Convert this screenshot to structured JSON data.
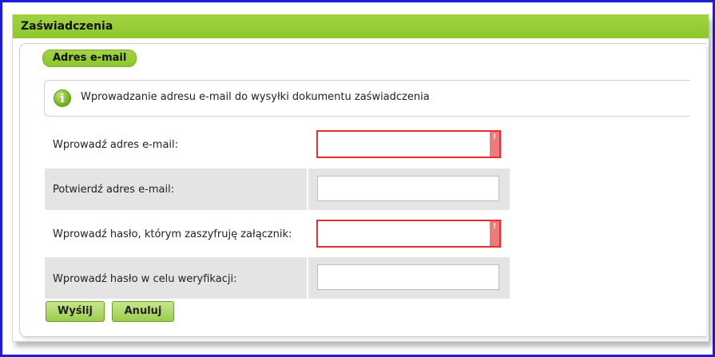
{
  "panel": {
    "title": "Zaświadczenia"
  },
  "section": {
    "legend": "Adres e-mail"
  },
  "info": {
    "icon": "info-icon",
    "text": "Wprowadzanie adresu e-mail do wysyłki dokumentu zaświadczenia"
  },
  "form": {
    "email_label": "Wprowadź adres e-mail:",
    "email_value": "",
    "confirm_email_label": "Potwierdź adres e-mail:",
    "confirm_email_value": "",
    "password_label": "Wprowadź hasło, którym zaszyfruję załącznik:",
    "password_value": "",
    "verify_password_label": "Wprowadź hasło w celu weryfikacji:",
    "verify_password_value": "",
    "error_mark": "!"
  },
  "buttons": {
    "send": "Wyślij",
    "cancel": "Anuluj"
  },
  "colors": {
    "accent": "#8ec62c",
    "error": "#e53030",
    "frame": "#1d1dd6",
    "row_shade": "#e4e4e4"
  }
}
